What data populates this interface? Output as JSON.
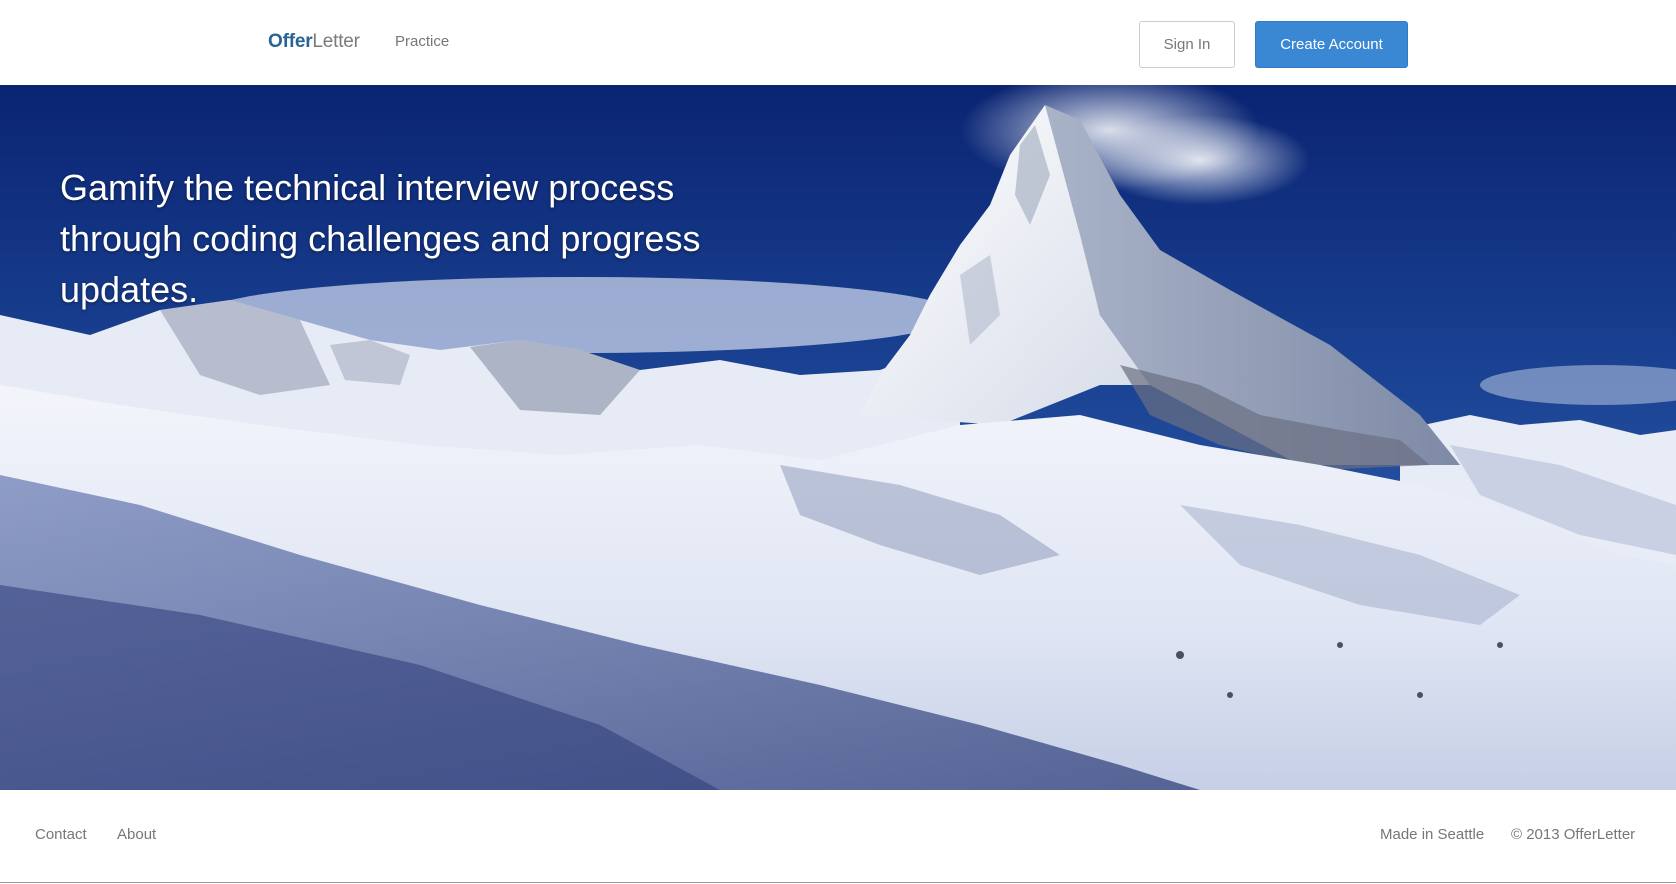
{
  "header": {
    "brand_part1": "Offer",
    "brand_part2": "Letter",
    "nav_practice": "Practice",
    "sign_in_label": "Sign In",
    "create_account_label": "Create Account"
  },
  "hero": {
    "headline": "Gamify the technical interview process through coding challenges and progress updates."
  },
  "footer": {
    "contact": "Contact",
    "about": "About",
    "made_in": "Made in Seattle",
    "copyright": "© 2013 OfferLetter"
  },
  "colors": {
    "brand_blue": "#2a6496",
    "primary_button": "#3a87d4",
    "muted_text": "#777777",
    "sky_dark": "#0d2a7a",
    "sky_light": "#3566b8"
  }
}
